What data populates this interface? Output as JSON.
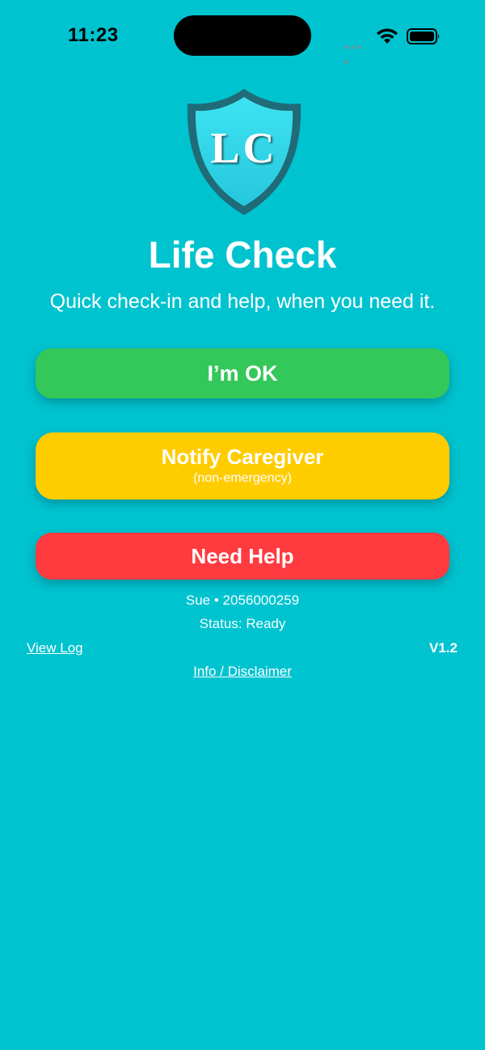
{
  "status_bar": {
    "time": "11:23",
    "icons": [
      "cellular-signal-icon",
      "wifi-icon",
      "battery-icon"
    ]
  },
  "logo": {
    "text": "LC",
    "icon": "shield-icon"
  },
  "header": {
    "title": "Life Check",
    "tagline": "Quick check-in and help, when you need it."
  },
  "actions": {
    "ok_label": "I’m OK",
    "notify_label": "Notify Caregiver",
    "notify_sublabel": "(non-emergency)",
    "help_label": "Need Help"
  },
  "info": {
    "user_line": "Sue • 2056000259",
    "status_line": "Status: Ready",
    "view_log_label": "View Log",
    "version": "V1.2",
    "info_link_label": "Info / Disclaimer"
  },
  "colors": {
    "background": "#00c3d0",
    "ok": "#34c759",
    "notify": "#ffcc00",
    "help": "#ff3b40",
    "shield": "#2fd6e8",
    "shield_border": "#1f6c78"
  }
}
